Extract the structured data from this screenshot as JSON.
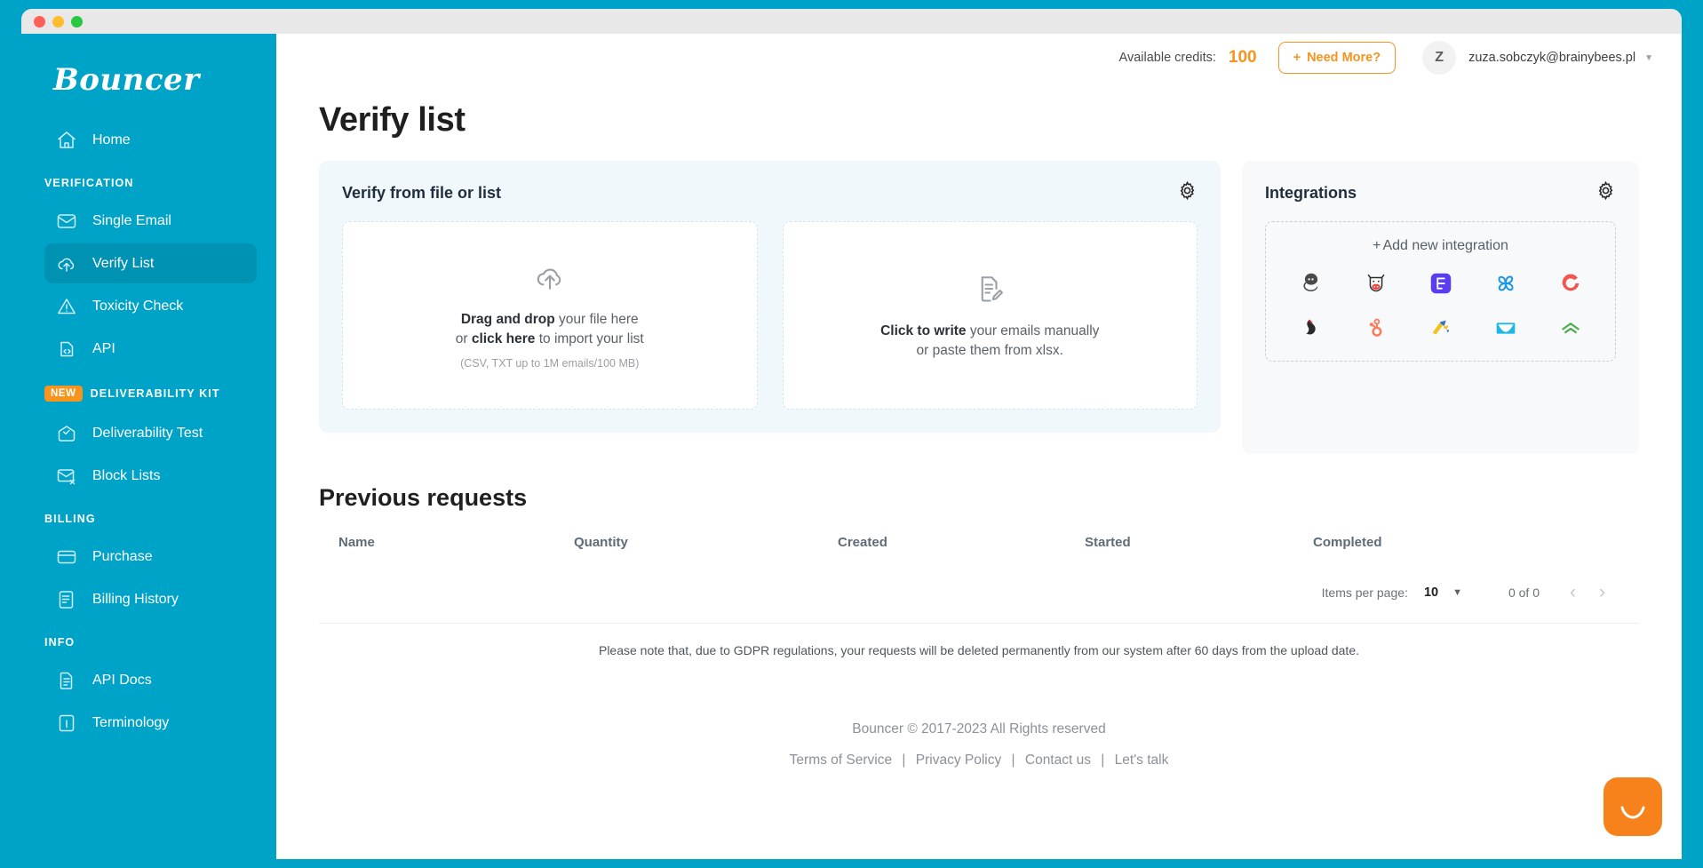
{
  "window": {
    "buttons": [
      "close",
      "minimize",
      "maximize"
    ]
  },
  "sidebar": {
    "brand": "Bouncer",
    "home": {
      "label": "Home",
      "icon": "home-icon"
    },
    "sections": [
      {
        "label": "VERIFICATION",
        "badge": null,
        "items": [
          {
            "label": "Single Email",
            "icon": "envelope-icon",
            "active": false
          },
          {
            "label": "Verify List",
            "icon": "cloud-upload-icon",
            "active": true
          },
          {
            "label": "Toxicity Check",
            "icon": "warning-triangle-icon",
            "active": false
          },
          {
            "label": "API",
            "icon": "code-brackets-icon",
            "active": false
          }
        ]
      },
      {
        "label": "DELIVERABILITY KIT",
        "badge": "NEW",
        "items": [
          {
            "label": "Deliverability Test",
            "icon": "envelope-check-icon",
            "active": false
          },
          {
            "label": "Block Lists",
            "icon": "envelope-x-icon",
            "active": false
          }
        ]
      },
      {
        "label": "BILLING",
        "badge": null,
        "items": [
          {
            "label": "Purchase",
            "icon": "credit-card-icon",
            "active": false
          },
          {
            "label": "Billing History",
            "icon": "invoice-icon",
            "active": false
          }
        ]
      },
      {
        "label": "INFO",
        "badge": null,
        "items": [
          {
            "label": "API Docs",
            "icon": "document-icon",
            "active": false
          },
          {
            "label": "Terminology",
            "icon": "info-icon",
            "active": false
          }
        ]
      }
    ]
  },
  "topbar": {
    "credits_label": "Available credits:",
    "credits_value": "100",
    "need_more_label": "Need More?",
    "need_more_plus": "+",
    "avatar_initial": "Z",
    "user_email": "zuza.sobczyk@brainybees.pl",
    "caret": "▼"
  },
  "page": {
    "title": "Verify list"
  },
  "verify_panel": {
    "title": "Verify from file or list",
    "gear_icon": "gear-icon",
    "dropzone_file": {
      "icon": "cloud-upload-icon",
      "line1_bold": "Drag and drop",
      "line1_rest": " your file here",
      "line2_pre": "or ",
      "line2_bold": "click here",
      "line2_rest": " to import your list",
      "sub": "(CSV, TXT up to 1M emails/100 MB)"
    },
    "dropzone_manual": {
      "icon": "document-edit-icon",
      "line1_bold": "Click to write",
      "line1_rest": " your emails manually",
      "line2": "or paste them from xlsx."
    }
  },
  "integrations_panel": {
    "title": "Integrations",
    "gear_icon": "gear-icon",
    "add_label": "Add new integration",
    "add_plus": "+",
    "icons": [
      "mailchimp-icon",
      "moosend-icon",
      "mailerlite-icon",
      "sendinblue-icon",
      "convertkit-icon",
      "sendgrid-icon",
      "hubspot-icon",
      "klaviyo-icon",
      "campaign-monitor-icon",
      "aweber-icon"
    ]
  },
  "previous_requests": {
    "title": "Previous requests",
    "columns": [
      "Name",
      "Quantity",
      "Created",
      "Started",
      "Completed"
    ],
    "rows": [],
    "pagination": {
      "items_per_page_label": "Items per page:",
      "items_per_page_value": "10",
      "caret": "▼",
      "range": "0 of 0",
      "prev": "‹",
      "next": "›"
    },
    "gdpr_notice": "Please note that, due to GDPR regulations, your requests will be deleted permanently from our system after 60 days from the upload date."
  },
  "footer": {
    "copyright": "Bouncer © 2017-2023 All Rights reserved",
    "links": [
      "Terms of Service",
      "Privacy Policy",
      "Contact us",
      "Let's talk"
    ],
    "separator": "|"
  },
  "chat": {
    "icon": "chat-smile-icon"
  },
  "colors": {
    "sidebar": "#00a3c8",
    "accent_orange": "#f7941e",
    "panel_left_bg": "#f0f8fb",
    "panel_right_bg": "#f8f9fa"
  }
}
